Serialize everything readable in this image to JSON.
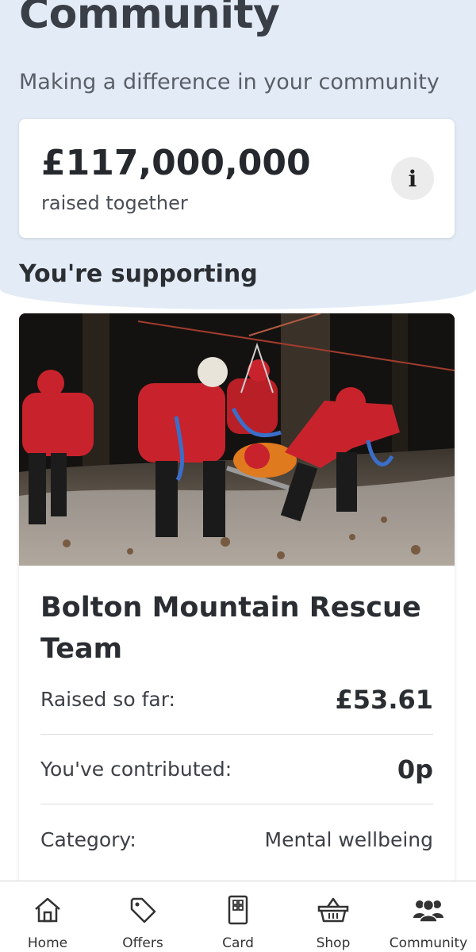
{
  "header": {
    "title": "Community",
    "subtitle": "Making a difference in your community"
  },
  "total": {
    "amount": "£117,000,000",
    "label": "raised together",
    "info_glyph": "i"
  },
  "section": {
    "title": "You're supporting"
  },
  "cause": {
    "name": "Bolton Mountain Rescue Team",
    "rows": [
      {
        "label": "Raised so far:",
        "value": "£53.61"
      },
      {
        "label": "You've contributed:",
        "value": "0p"
      },
      {
        "label": "Category:",
        "value": "Mental wellbeing"
      }
    ]
  },
  "nav": {
    "items": [
      {
        "label": "Home",
        "icon": "home-icon"
      },
      {
        "label": "Offers",
        "icon": "tag-icon"
      },
      {
        "label": "Card",
        "icon": "card-icon"
      },
      {
        "label": "Shop",
        "icon": "basket-icon"
      },
      {
        "label": "Community",
        "icon": "people-icon"
      }
    ]
  },
  "colors": {
    "hero_background": "#e3ecf6",
    "rescue_red": "#c8232c"
  }
}
